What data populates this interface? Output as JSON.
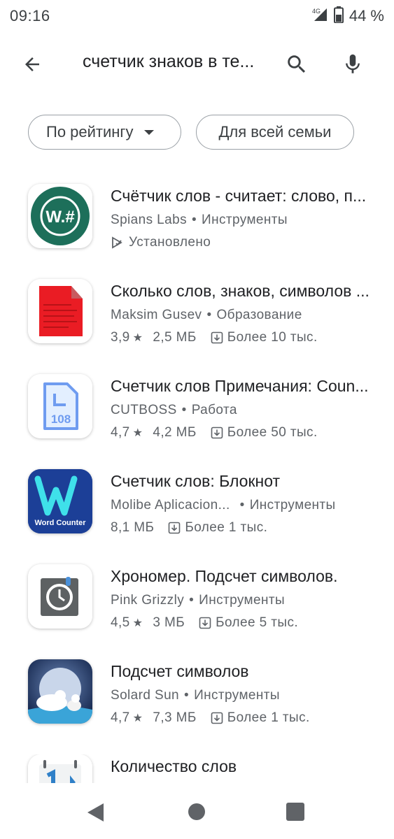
{
  "status_bar": {
    "time": "09:16",
    "network": "4G",
    "battery": "44 %"
  },
  "search": {
    "query": "счетчик знаков в те..."
  },
  "filters": [
    {
      "label": "По рейтингу"
    },
    {
      "label": "Для всей семьи"
    }
  ],
  "apps": [
    {
      "title": "Счётчик слов - считает: слово, п...",
      "developer": "Spians Labs",
      "category": "Инструменты",
      "status": "Установлено",
      "icon_text": "W.#"
    },
    {
      "title": "Сколько слов, знаков, символов ...",
      "developer": "Maksim Gusev",
      "category": "Образование",
      "rating": "3,9",
      "size": "2,5 МБ",
      "downloads": "Более 10 тыс."
    },
    {
      "title": "Счетчик слов Примечания: Coun...",
      "developer": "CUTBOSS",
      "category": "Работа",
      "rating": "4,7",
      "size": "4,2 МБ",
      "downloads": "Более 50 тыс.",
      "icon_text": "108"
    },
    {
      "title": "Счетчик слов: Блокнот",
      "developer": "Molibe Aplicacion...",
      "category": "Инструменты",
      "size": "8,1 МБ",
      "downloads": "Более 1 тыс.",
      "icon_text": "Word Counter"
    },
    {
      "title": "Хрономер. Подсчет символов.",
      "developer": "Pink Grizzly",
      "category": "Инструменты",
      "rating": "4,5",
      "size": "3 МБ",
      "downloads": "Более 5 тыс."
    },
    {
      "title": "Подсчет символов",
      "developer": "Solard Sun",
      "category": "Инструменты",
      "rating": "4,7",
      "size": "7,3 МБ",
      "downloads": "Более 1 тыс."
    },
    {
      "title": "Количество слов"
    }
  ],
  "colors": {
    "text": "#202124",
    "secondary": "#5f6368",
    "chip_border": "#9aa0a6"
  },
  "icons": [
    "back-arrow-icon",
    "search-icon",
    "mic-icon",
    "caret-down-icon",
    "installed-icon",
    "star-icon",
    "download-icon"
  ]
}
